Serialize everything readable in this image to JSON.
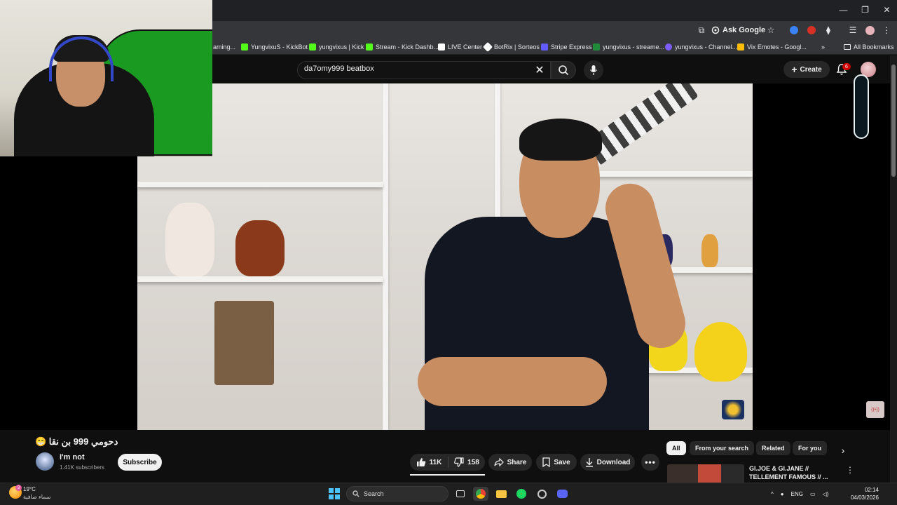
{
  "browser": {
    "ask_google": "Ask Google",
    "bookmarks": [
      {
        "label": "aming...",
        "color": "#9146ff"
      },
      {
        "label": "YungvixuS - KickBot",
        "color": "#53fc18"
      },
      {
        "label": "yungvixus | Kick",
        "color": "#53fc18"
      },
      {
        "label": "Stream - Kick Dashb...",
        "color": "#53fc18"
      },
      {
        "label": "LIVE Center",
        "color": "#ffffff"
      },
      {
        "label": "BotRix | Sorteos",
        "color": "#ffffff"
      },
      {
        "label": "Stripe Express",
        "color": "#635bff"
      },
      {
        "label": "yungvixus - streame...",
        "color": "#1f8a3a"
      },
      {
        "label": "yungvixus - Channel...",
        "color": "#7c5cff"
      },
      {
        "label": "Vix Emotes - Googl...",
        "color": "#fbbc04"
      }
    ],
    "all_bookmarks": "All Bookmarks"
  },
  "youtube": {
    "search_value": "da7omy999 beatbox",
    "create_label": "Create",
    "notifications_count": "6"
  },
  "video": {
    "title": "دحومي 999 بن نقا 😁",
    "channel_name": "I'm not",
    "subscribers": "1.41K subscribers",
    "subscribe_label": "Subscribe",
    "likes": "11K",
    "dislikes": "158",
    "share_label": "Share",
    "save_label": "Save",
    "download_label": "Download"
  },
  "chips": [
    "All",
    "From your search",
    "Related",
    "For you"
  ],
  "related": {
    "title": "GI.JOE & GI.JANE // TELLEMENT FAMOUS // ..."
  },
  "taskbar": {
    "weather_temp": "19°C",
    "weather_badge": "3",
    "weather_desc": "سماء صافية",
    "search_label": "Search",
    "language": "ENG",
    "time": "02:14",
    "date": "04/03/2026"
  },
  "colors": {
    "accent_red": "#cc0000",
    "background": "#0f0f0f"
  }
}
